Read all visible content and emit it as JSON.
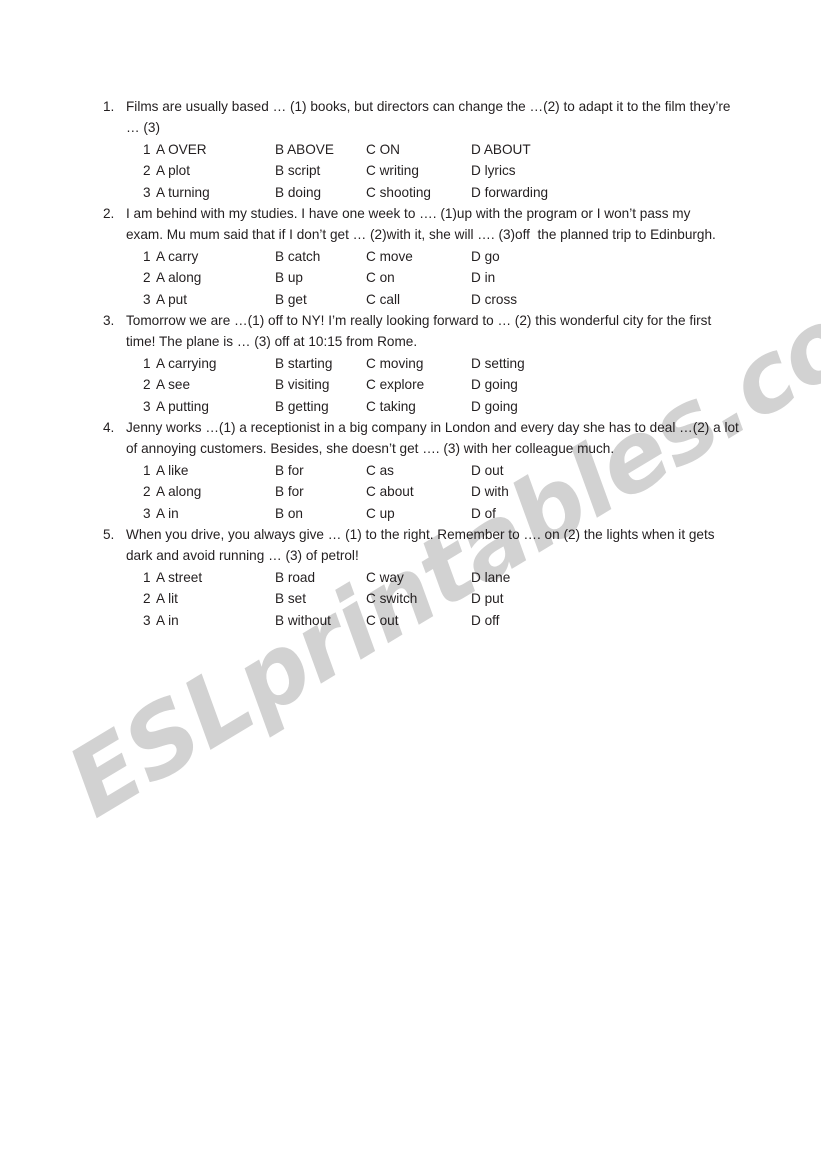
{
  "page": {
    "background_color": "#ffffff",
    "text_color": "#231f20"
  },
  "watermark": {
    "text": "ESLprintables.com",
    "color": "#d2d2d2"
  },
  "worksheet": {
    "questions": [
      {
        "number": "1.",
        "lines": [
          "Films are usually based … (1) books, but directors can change the …(2) to adapt it to the film they’re",
          "… (3)"
        ],
        "options": [
          {
            "index": "1",
            "a": "A OVER",
            "b": "B ABOVE",
            "c": "C ON",
            "d": "D ABOUT"
          },
          {
            "index": "2",
            "a": "A plot",
            "b": "B script",
            "c": "C writing",
            "d": "D lyrics"
          },
          {
            "index": "3",
            "a": "A turning",
            "b": "B doing",
            "c": "C shooting",
            "d": "D forwarding"
          }
        ]
      },
      {
        "number": "2.",
        "lines": [
          "I am behind with my studies. I have one week to …. (1)up with the program or I won’t pass my",
          "exam. Mu mum said that if I don’t get … (2)with it, she will …. (3)off  the planned trip to Edinburgh."
        ],
        "options": [
          {
            "index": "1",
            "a": "A carry",
            "b": "B catch",
            "c": "C move",
            "d": "D go"
          },
          {
            "index": "2",
            "a": "A along",
            "b": "B up",
            "c": "C on",
            "d": "D in"
          },
          {
            "index": "3",
            "a": "A put",
            "b": "B get",
            "c": "C call",
            "d": "D cross"
          }
        ]
      },
      {
        "number": "3.",
        "lines": [
          "Tomorrow we are …(1) off to NY! I’m really looking forward to … (2) this wonderful city for the first",
          "time! The plane is … (3) off at 10:15 from Rome."
        ],
        "options": [
          {
            "index": "1",
            "a": "A carrying",
            "b": "B starting",
            "c": "C moving",
            "d": "D setting"
          },
          {
            "index": "2",
            "a": "A see",
            "b": "B visiting",
            "c": "C explore",
            "d": "D going"
          },
          {
            "index": "3",
            "a": "A putting",
            "b": "B getting",
            "c": "C taking",
            "d": "D going"
          }
        ]
      },
      {
        "number": "4.",
        "lines": [
          "Jenny works …(1) a receptionist in a big company in London and every day she has to deal …(2) a lot",
          "of annoying customers. Besides, she doesn’t get …. (3) with her colleague much."
        ],
        "options": [
          {
            "index": "1",
            "a": "A like",
            "b": "B for",
            "c": "C as",
            "d": "D out"
          },
          {
            "index": "2",
            "a": "A along",
            "b": "B for",
            "c": "C about",
            "d": "D with"
          },
          {
            "index": "3",
            "a": "A in",
            "b": "B on",
            "c": "C up",
            "d": "D of"
          }
        ]
      },
      {
        "number": "5.",
        "lines": [
          "When you drive, you always give … (1) to the right. Remember to …. on (2) the lights when it gets",
          "dark and avoid running … (3) of petrol!"
        ],
        "options": [
          {
            "index": "1",
            "a": "A street",
            "b": "B road",
            "c": "C way",
            "d": "D lane"
          },
          {
            "index": "2",
            "a": "A lit",
            "b": "B set",
            "c": "C switch",
            "d": "D put"
          },
          {
            "index": "3",
            "a": "A in",
            "b": "B without",
            "c": "C out",
            "d": "D off"
          }
        ]
      }
    ]
  }
}
